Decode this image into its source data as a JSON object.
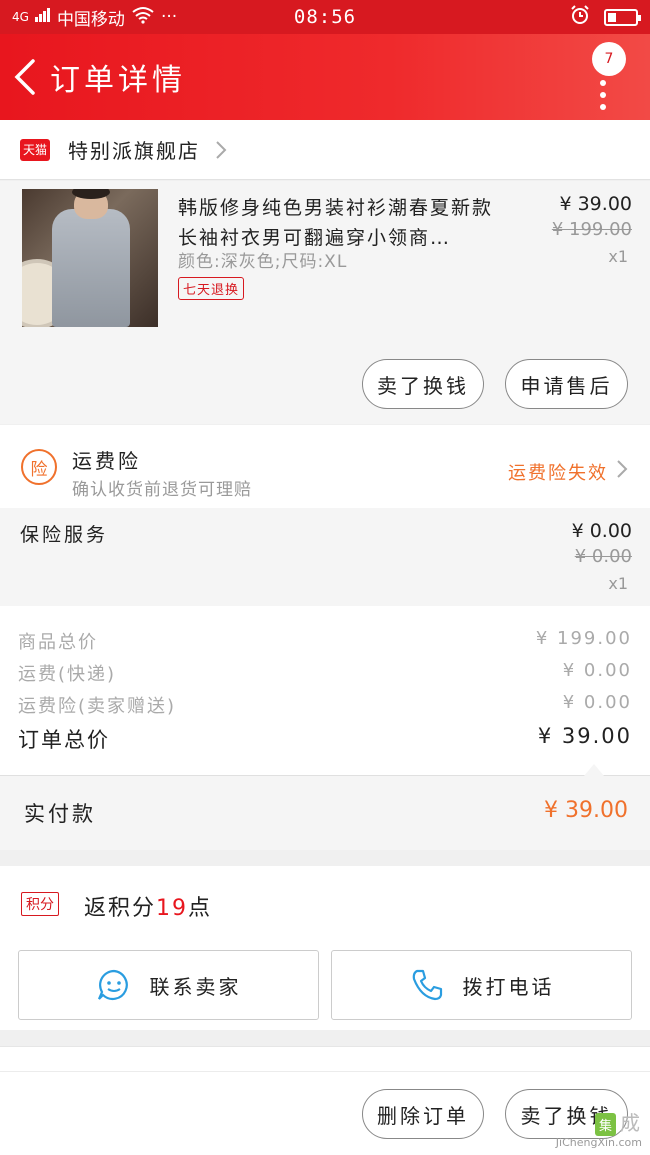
{
  "status_bar": {
    "carrier": "中国移动",
    "signal_label": "4G",
    "more": "···",
    "time": "08:56",
    "battery_level": 0.3
  },
  "header": {
    "title": "订单详情",
    "badge_count": "7"
  },
  "shop": {
    "platform_label": "天猫",
    "name": "特别派旗舰店"
  },
  "product": {
    "title": "韩版修身纯色男装衬衫潮春夏新款长袖衬衣男可翻遍穿小领商…",
    "spec": "颜色:深灰色;尺码:XL",
    "tag": "七天退换",
    "price": "¥ 39.00",
    "original_price": "¥ 199.00",
    "quantity": "x1",
    "buttons": [
      "卖了换钱",
      "申请售后"
    ]
  },
  "insurance": {
    "icon_label": "险",
    "title": "运费险",
    "subtitle": "确认收货前退货可理赔",
    "status": "运费险失效"
  },
  "service": {
    "label": "保险服务",
    "price": "¥ 0.00",
    "original_price": "¥ 0.00",
    "quantity": "x1"
  },
  "summary": {
    "rows": [
      {
        "label": "商品总价",
        "value": "¥ 199.00"
      },
      {
        "label": "运费(快递)",
        "value": "¥ 0.00"
      },
      {
        "label": "运费险(卖家赠送)",
        "value": "¥ 0.00"
      }
    ],
    "total_label": "订单总价",
    "total_value": "¥ 39.00"
  },
  "paid": {
    "label": "实付款",
    "value": "¥ 39.00"
  },
  "points": {
    "badge": "积分",
    "prefix": "返积分",
    "count": "19",
    "suffix": "点"
  },
  "contact": {
    "seller_label": "联系卖家",
    "phone_label": "拨打电话"
  },
  "bottom": {
    "buttons": [
      "删除订单",
      "卖了换钱"
    ]
  },
  "watermark": {
    "logo": "集",
    "brand": "成",
    "site": "JiChengXin.com"
  },
  "colors": {
    "brand_red": "#d71920",
    "accent_orange": "#f0712c"
  }
}
